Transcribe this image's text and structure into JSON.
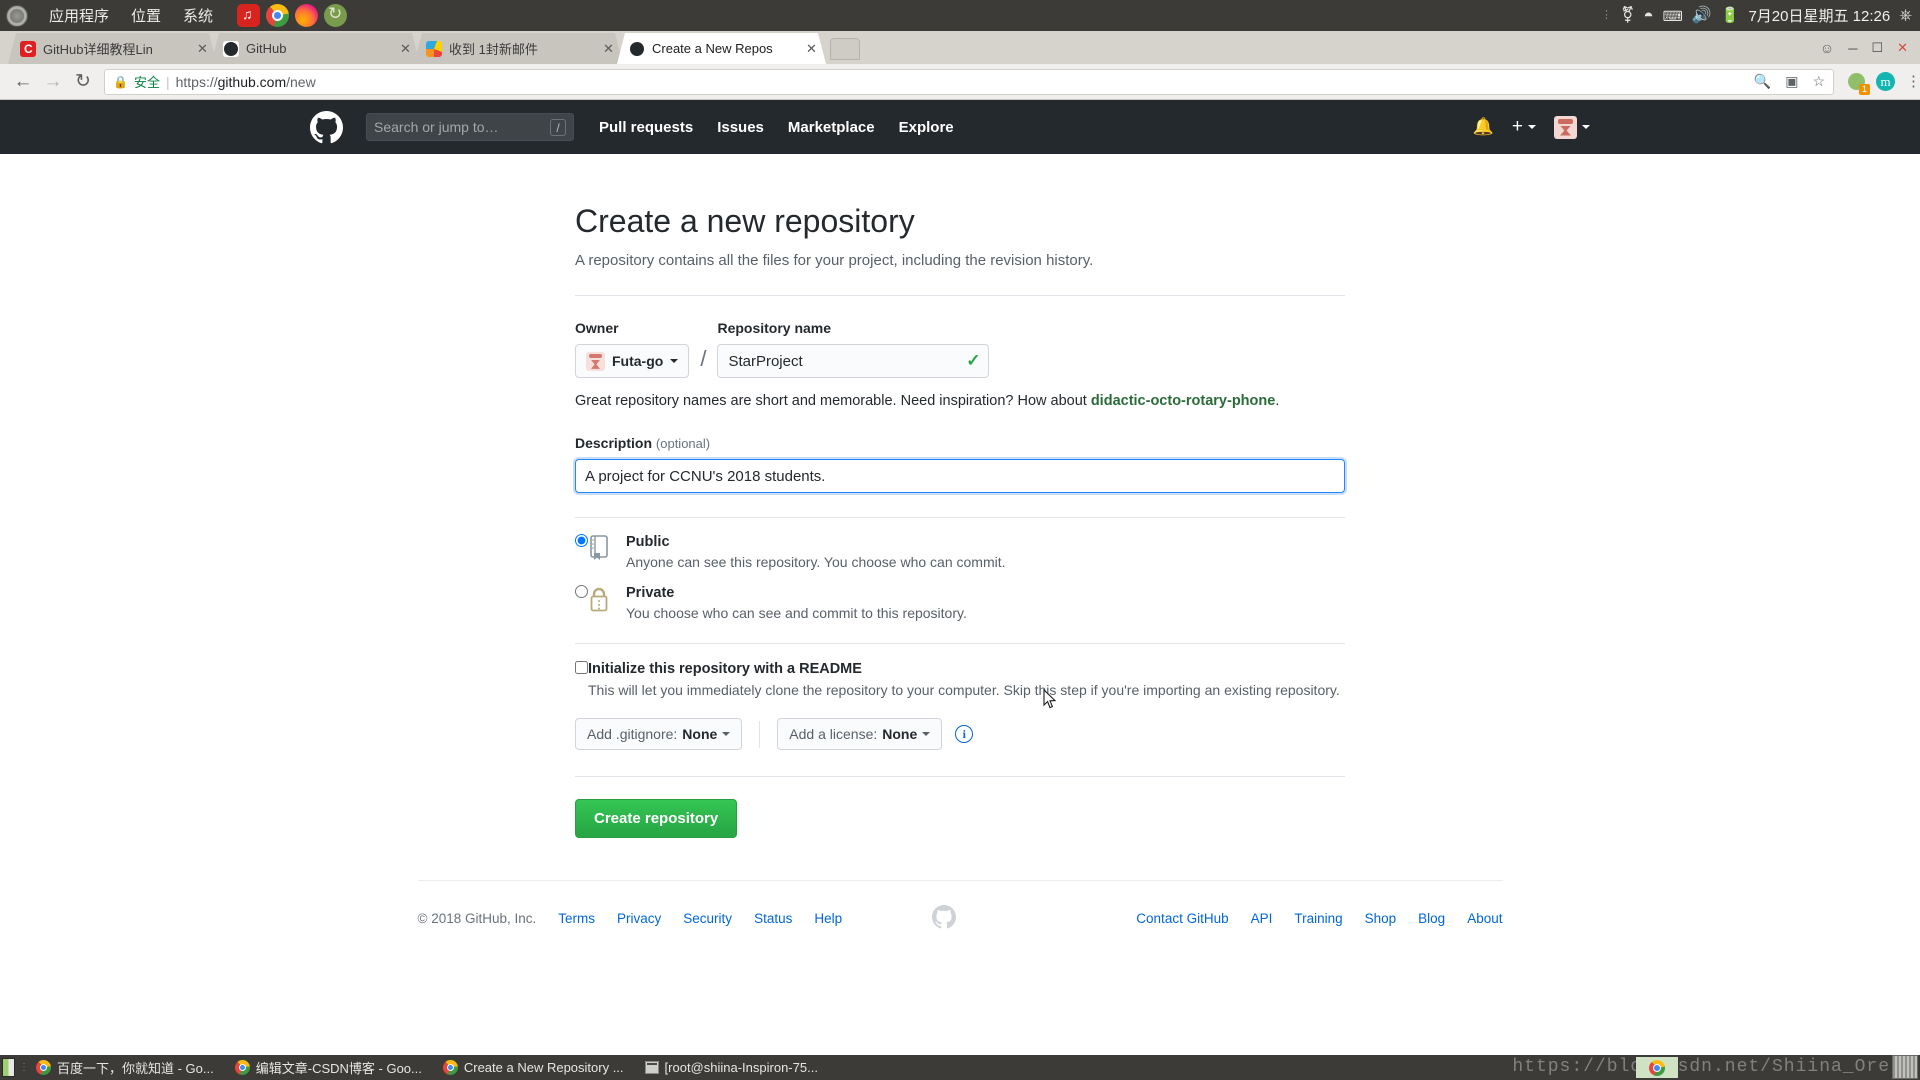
{
  "os_panel": {
    "apps_icon": "gnome-apps-icon",
    "menus": [
      "应用程序",
      "位置",
      "系统"
    ],
    "launchers": [
      "netease-music-icon",
      "chrome-icon",
      "firefox-icon",
      "sync-icon"
    ],
    "tray_icons": [
      "bluetooth-icon",
      "wifi-icon",
      "keyboard-icon",
      "volume-icon",
      "battery-icon"
    ],
    "clock": "7月20日星期五  12:26",
    "power_icon": "power-icon"
  },
  "browser": {
    "tabs": [
      {
        "title": "GitHub详细教程Lin",
        "favicon": "csdn-favicon",
        "active": false
      },
      {
        "title": "GitHub",
        "favicon": "github-favicon",
        "active": false
      },
      {
        "title": "收到 1封新邮件",
        "favicon": "mail-favicon",
        "active": false
      },
      {
        "title": "Create a New Repos",
        "favicon": "github-favicon",
        "active": true
      }
    ],
    "new_tab_label": "",
    "window_controls": [
      "profile-icon",
      "minimize",
      "maximize",
      "close"
    ],
    "nav": {
      "back": "←",
      "forward": "→",
      "reload": "⟳"
    },
    "omnibox": {
      "lock_icon": "lock-icon",
      "secure_label": "安全",
      "url_scheme": "https://",
      "url_host": "github.com",
      "url_path": "/new"
    },
    "toolbar_icons": [
      "zoom-icon",
      "translate-icon",
      "bookmark-star-icon",
      "extension-icon",
      "mendeley-icon",
      "menu-kebab-icon"
    ],
    "extension_badge": "1",
    "extension_letter": "m"
  },
  "github": {
    "header": {
      "logo": "github-mark-icon",
      "search_placeholder": "Search or jump to…",
      "search_key_hint": "/",
      "nav": [
        "Pull requests",
        "Issues",
        "Marketplace",
        "Explore"
      ],
      "notifications_icon": "bell-icon",
      "new_icon": "plus-icon",
      "avatar": "user-avatar"
    },
    "page": {
      "title": "Create a new repository",
      "subtitle": "A repository contains all the files for your project, including the revision history.",
      "owner_label": "Owner",
      "owner_value": "Futa-go",
      "separator": "/",
      "repo_name_label": "Repository name",
      "repo_name_value": "StarProject",
      "repo_name_valid_icon": "check-icon",
      "hint_prefix": "Great repository names are short and memorable. Need inspiration? How about ",
      "hint_suggestion": "didactic-octo-rotary-phone",
      "hint_suffix": ".",
      "description_label": "Description",
      "description_optional": "(optional)",
      "description_value": "A project for CCNU's 2018 students.",
      "description_misspelled": "CCNU's",
      "visibility": [
        {
          "id": "public",
          "title": "Public",
          "desc": "Anyone can see this repository. You choose who can commit.",
          "icon": "book-icon",
          "selected": true
        },
        {
          "id": "private",
          "title": "Private",
          "desc": "You choose who can see and commit to this repository.",
          "icon": "lock-icon",
          "selected": false
        }
      ],
      "readme_label": "Initialize this repository with a README",
      "readme_desc": "This will let you immediately clone the repository to your computer. Skip this step if you're importing an existing repository.",
      "readme_checked": false,
      "gitignore_prefix": "Add .gitignore: ",
      "gitignore_value": "None",
      "license_prefix": "Add a license: ",
      "license_value": "None",
      "info_icon": "info-icon",
      "create_button": "Create repository"
    },
    "footer": {
      "copyright": "© 2018 GitHub, Inc.",
      "left_links": [
        "Terms",
        "Privacy",
        "Security",
        "Status",
        "Help"
      ],
      "mark": "github-mark-icon",
      "right_links": [
        "Contact GitHub",
        "API",
        "Training",
        "Shop",
        "Blog",
        "About"
      ]
    }
  },
  "taskbar": {
    "show_desktop_icon": "show-desktop-icon",
    "items": [
      {
        "icon": "chrome-icon",
        "label": "百度一下，你就知道 - Go..."
      },
      {
        "icon": "chrome-icon",
        "label": "编辑文章-CSDN博客 - Goo..."
      },
      {
        "icon": "chrome-icon",
        "label": "Create a New Repository ..."
      },
      {
        "icon": "terminal-icon",
        "label": "[root@shiina-Inspiron-75..."
      }
    ]
  },
  "watermark": "https://blog.csdn.net/Shiina_Ore",
  "colors": {
    "gh_header_bg": "#24292e",
    "gh_link": "#0366d6",
    "green_button": "#28a745",
    "panel_bg": "#3c3b37",
    "focus_blue": "#2188ff"
  }
}
